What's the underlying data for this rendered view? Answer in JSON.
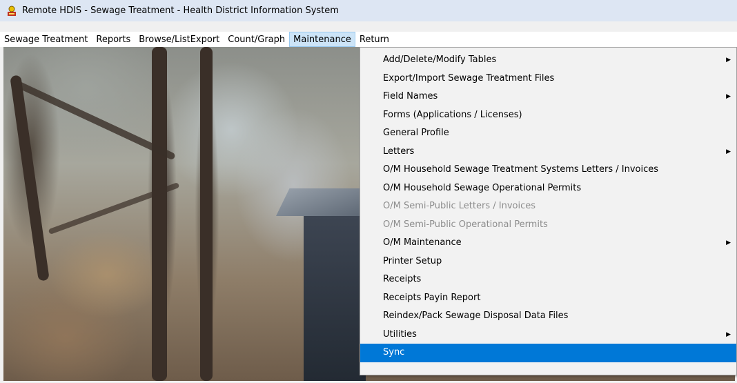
{
  "window": {
    "title": "Remote HDIS - Sewage Treatment - Health District Information System",
    "icon": "app-logo-icon"
  },
  "menubar": {
    "items": [
      {
        "label": "Sewage Treatment"
      },
      {
        "label": "Reports"
      },
      {
        "label": "Browse/ListExport"
      },
      {
        "label": "Count/Graph"
      },
      {
        "label": "Maintenance",
        "active": true
      },
      {
        "label": "Return"
      }
    ]
  },
  "maintenance_menu": {
    "items": [
      {
        "label": "Add/Delete/Modify Tables",
        "submenu": true
      },
      {
        "label": "Export/Import Sewage Treatment Files"
      },
      {
        "label": "Field Names",
        "submenu": true
      },
      {
        "label": "Forms (Applications / Licenses)"
      },
      {
        "label": "General Profile"
      },
      {
        "label": "Letters",
        "submenu": true
      },
      {
        "label": "O/M Household Sewage Treatment Systems Letters / Invoices"
      },
      {
        "label": "O/M Household Sewage Operational Permits"
      },
      {
        "label": "O/M Semi-Public Letters / Invoices",
        "disabled": true
      },
      {
        "label": "O/M Semi-Public Operational Permits",
        "disabled": true
      },
      {
        "label": "O/M Maintenance",
        "submenu": true
      },
      {
        "label": "Printer Setup"
      },
      {
        "label": "Receipts"
      },
      {
        "label": "Receipts Payin Report"
      },
      {
        "label": "Reindex/Pack Sewage Disposal Data Files"
      },
      {
        "label": "Utilities",
        "submenu": true
      },
      {
        "label": "Sync",
        "highlighted": true
      }
    ],
    "submenu_glyph": "▶"
  },
  "colors": {
    "highlight": "#0078d7",
    "active_menu": "#cce4f7",
    "disabled_text": "#8d8d8d"
  }
}
